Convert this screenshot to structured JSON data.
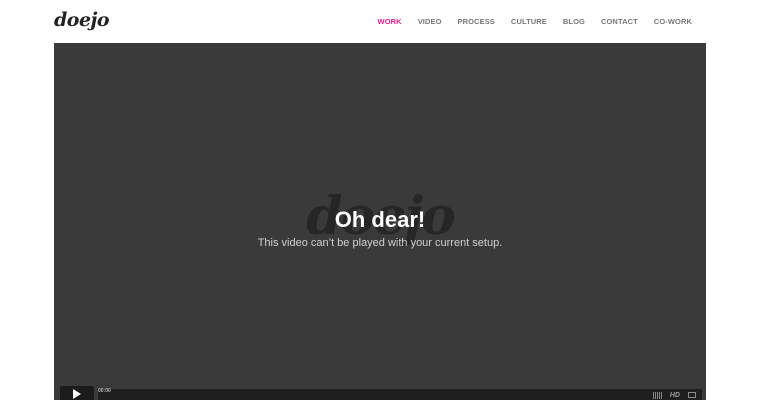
{
  "header": {
    "logo": "doejo",
    "nav": [
      {
        "label": "WORK",
        "active": true
      },
      {
        "label": "VIDEO",
        "active": false
      },
      {
        "label": "PROCESS",
        "active": false
      },
      {
        "label": "CULTURE",
        "active": false
      },
      {
        "label": "BLOG",
        "active": false
      },
      {
        "label": "CONTACT",
        "active": false
      },
      {
        "label": "CO-WORK",
        "active": false
      }
    ],
    "accent_color": "#e0208a"
  },
  "player": {
    "watermark": "doejo",
    "error_title": "Oh dear!",
    "error_message": "This video can’t be played with your current setup.",
    "time": "00:00",
    "hd_label": "HD",
    "play_icon": "play-icon",
    "volume_icon": "volume-icon",
    "fullscreen_icon": "fullscreen-icon"
  }
}
